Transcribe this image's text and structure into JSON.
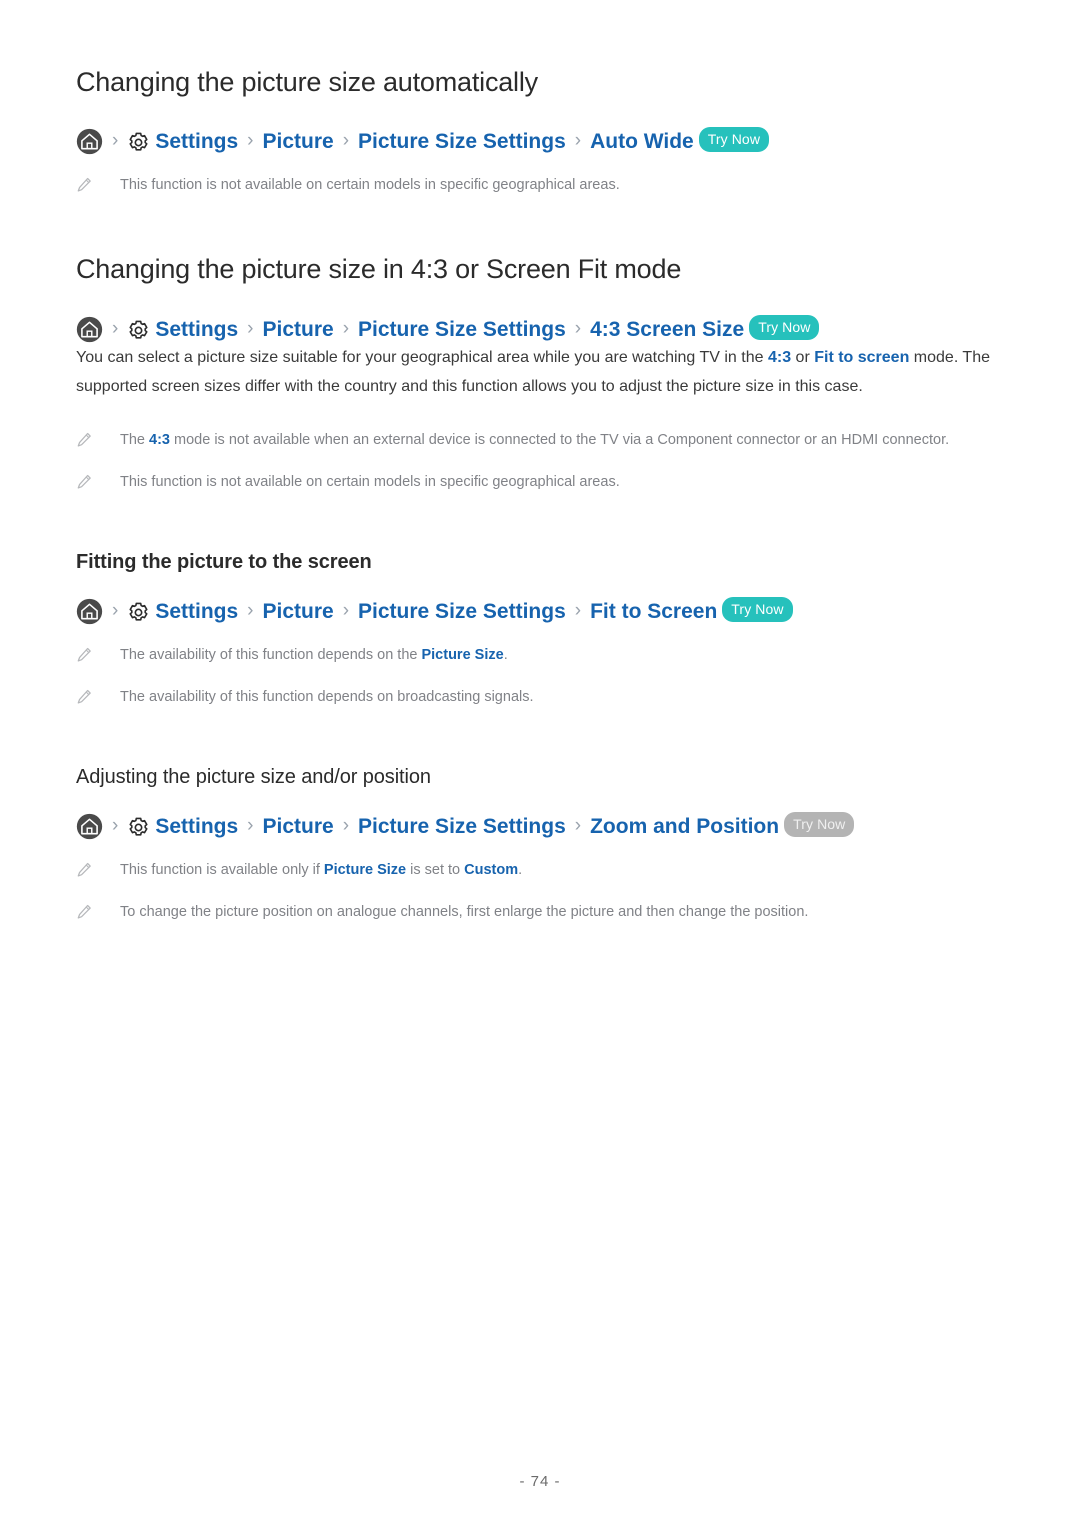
{
  "document": {
    "page_number": "- 74 -",
    "colors": {
      "link_blue": "#1763ae",
      "try_now_teal": "#26c1bc",
      "try_now_disabled": "#b4b4b4",
      "note_gray": "#808287",
      "heading": "#2b2b2b"
    }
  },
  "sections": [
    {
      "heading": "Changing the picture size automatically",
      "breadcrumb": {
        "home_icon": "home-icon",
        "gear_icon": "gear-icon",
        "separator": "›",
        "items": [
          "Settings",
          "Picture",
          "Picture Size Settings",
          "Auto Wide"
        ],
        "try_now": "Try Now",
        "try_now_state": "active"
      },
      "notes": [
        {
          "icon": "pencil-note-icon",
          "parts": [
            {
              "text": "This function is not available on certain models in specific geographical areas.",
              "style": "plain"
            }
          ]
        }
      ]
    },
    {
      "heading": "Changing the picture size in 4:3 or Screen Fit mode",
      "breadcrumb": {
        "home_icon": "home-icon",
        "gear_icon": "gear-icon",
        "separator": "›",
        "items": [
          "Settings",
          "Picture",
          "Picture Size Settings",
          "4:3 Screen Size"
        ],
        "try_now": "Try Now",
        "try_now_state": "active"
      },
      "paragraph_parts": [
        {
          "text": "You can select a picture size suitable for your geographical area while you are watching TV in the ",
          "style": "plain"
        },
        {
          "text": "4:3",
          "style": "link"
        },
        {
          "text": " or ",
          "style": "plain"
        },
        {
          "text": "Fit to screen",
          "style": "link"
        },
        {
          "text": " mode. The supported screen sizes differ with the country and this function allows you to adjust the picture size in this case.",
          "style": "plain"
        }
      ],
      "notes": [
        {
          "icon": "pencil-note-icon",
          "parts": [
            {
              "text": "The ",
              "style": "plain"
            },
            {
              "text": "4:3",
              "style": "link"
            },
            {
              "text": " mode is not available when an external device is connected to the TV via a Component connector or an HDMI connector.",
              "style": "plain"
            }
          ]
        },
        {
          "icon": "pencil-note-icon",
          "parts": [
            {
              "text": "This function is not available on certain models in specific geographical areas.",
              "style": "plain"
            }
          ]
        }
      ],
      "subsections": [
        {
          "heading": "Fitting the picture to the screen",
          "heading_weight": "bold",
          "breadcrumb": {
            "home_icon": "home-icon",
            "gear_icon": "gear-icon",
            "separator": "›",
            "items": [
              "Settings",
              "Picture",
              "Picture Size Settings",
              "Fit to Screen"
            ],
            "try_now": "Try Now",
            "try_now_state": "active"
          },
          "notes": [
            {
              "icon": "pencil-note-icon",
              "parts": [
                {
                  "text": "The availability of this function depends on the ",
                  "style": "plain"
                },
                {
                  "text": "Picture Size",
                  "style": "link"
                },
                {
                  "text": ".",
                  "style": "plain"
                }
              ]
            },
            {
              "icon": "pencil-note-icon",
              "parts": [
                {
                  "text": "The availability of this function depends on broadcasting signals.",
                  "style": "plain"
                }
              ]
            }
          ]
        },
        {
          "heading": "Adjusting the picture size and/or position",
          "heading_weight": "light",
          "breadcrumb": {
            "home_icon": "home-icon",
            "gear_icon": "gear-icon",
            "separator": "›",
            "items": [
              "Settings",
              "Picture",
              "Picture Size Settings",
              "Zoom and Position"
            ],
            "try_now": "Try Now",
            "try_now_state": "disabled"
          },
          "notes": [
            {
              "icon": "pencil-note-icon",
              "parts": [
                {
                  "text": "This function is available only if ",
                  "style": "plain"
                },
                {
                  "text": "Picture Size",
                  "style": "link"
                },
                {
                  "text": " is set to ",
                  "style": "plain"
                },
                {
                  "text": "Custom",
                  "style": "link"
                },
                {
                  "text": ".",
                  "style": "plain"
                }
              ]
            },
            {
              "icon": "pencil-note-icon",
              "parts": [
                {
                  "text": "To change the picture position on analogue channels, first enlarge the picture and then change the position.",
                  "style": "plain"
                }
              ]
            }
          ]
        }
      ]
    }
  ]
}
